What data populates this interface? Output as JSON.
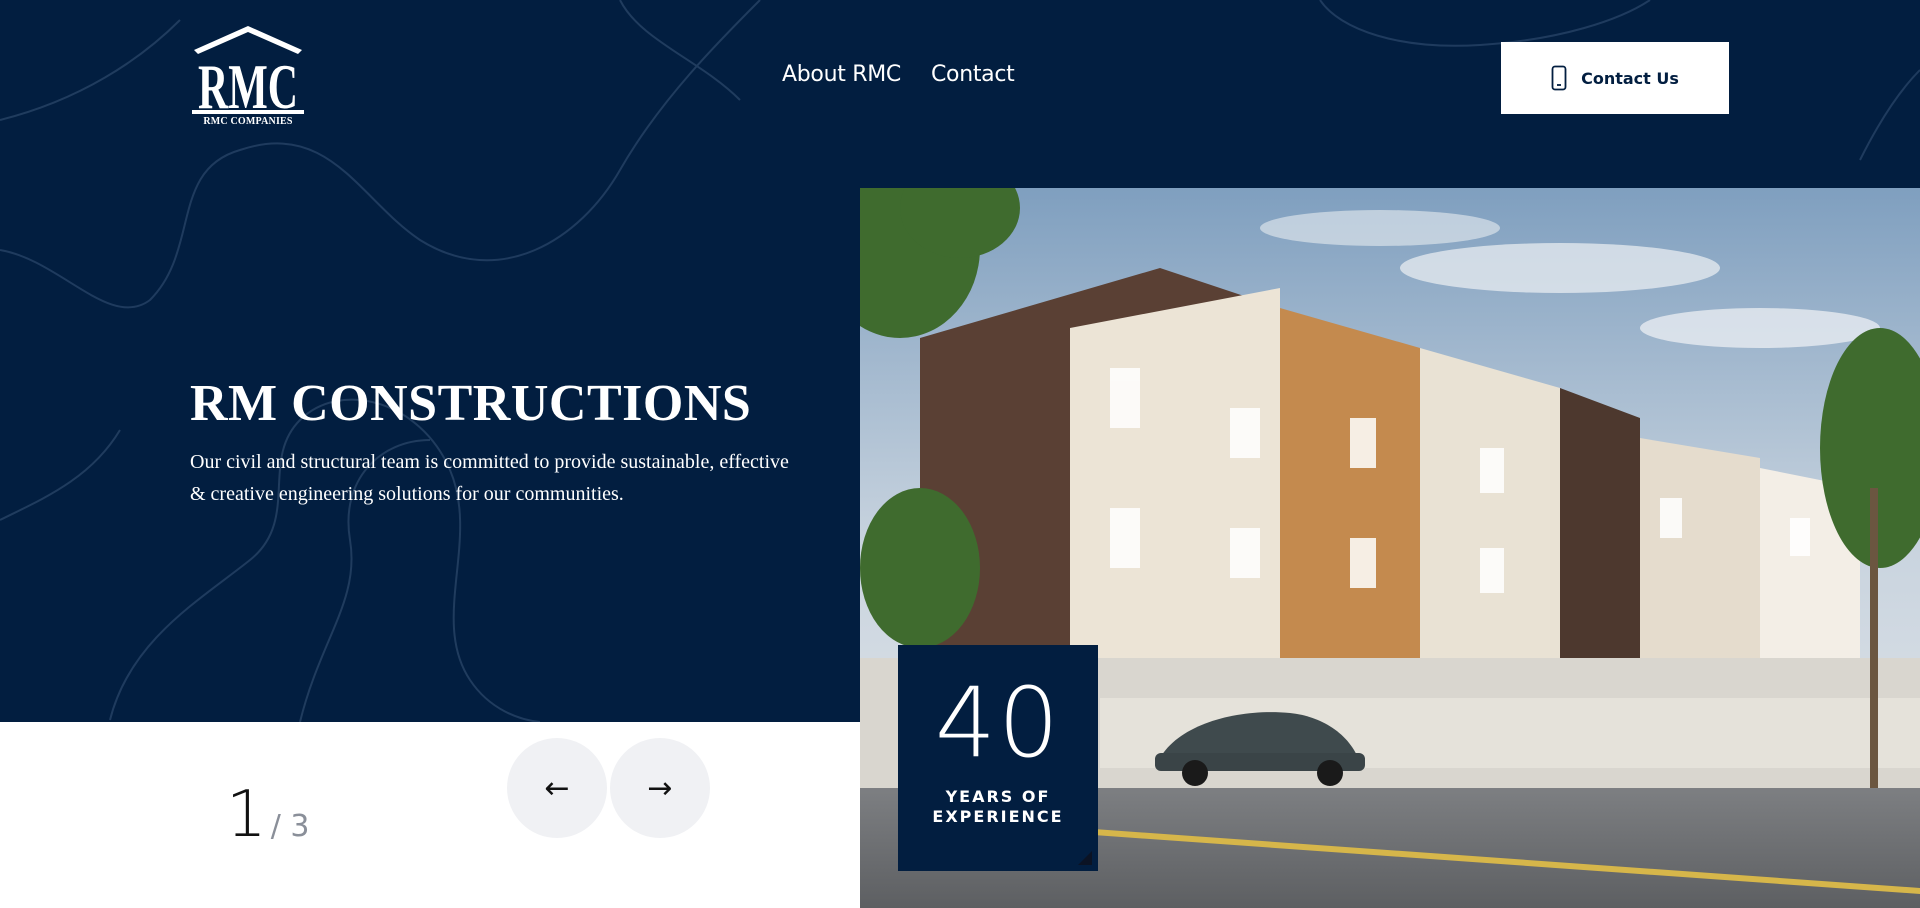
{
  "brand": {
    "logo_text": "RMC",
    "logo_subtext": "RMC COMPANIES",
    "logo_icon": "house-roof-logo"
  },
  "nav": {
    "items": [
      {
        "label": "About RMC"
      },
      {
        "label": "Contact"
      }
    ]
  },
  "cta": {
    "label": "Contact Us",
    "icon": "phone-icon"
  },
  "hero": {
    "title": "RM CONSTRUCTIONS",
    "description": "Our civil and structural team is committed to provide sustainable, effective & creative engineering solutions for our communities."
  },
  "experience": {
    "number": "40",
    "label_line1": "YEARS OF",
    "label_line2": "EXPERIENCE"
  },
  "slider": {
    "current": "1",
    "total": "/ 3",
    "prev_icon": "arrow-left-icon",
    "next_icon": "arrow-right-icon",
    "prev_glyph": "←",
    "next_glyph": "→"
  },
  "colors": {
    "navy": "#021e40",
    "white": "#ffffff",
    "button_gray": "#f0f1f4"
  }
}
